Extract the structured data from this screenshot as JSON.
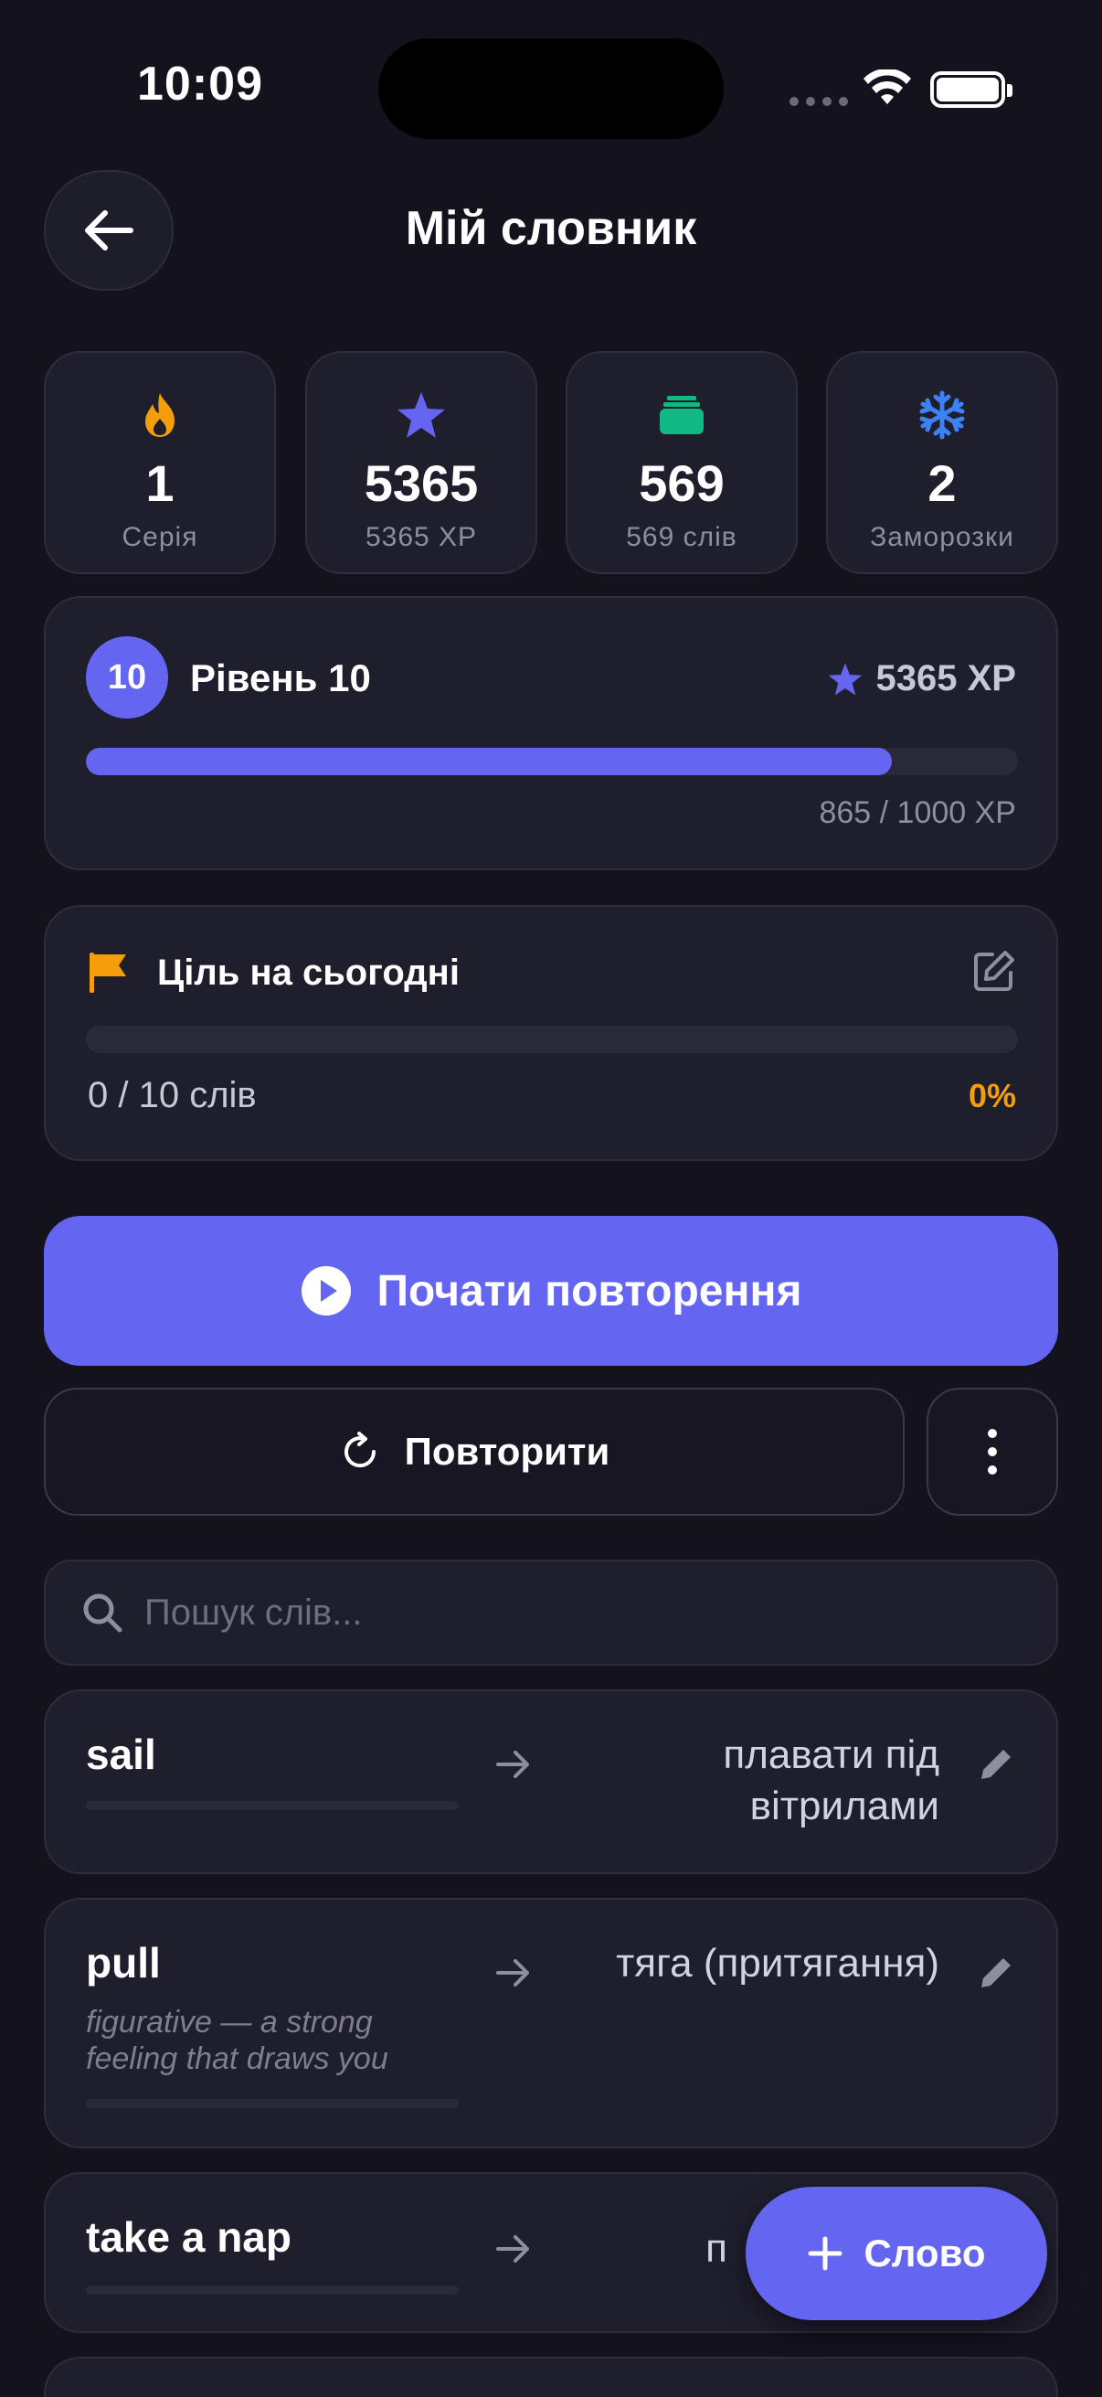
{
  "status": {
    "time": "10:09"
  },
  "header": {
    "title": "Мій словник"
  },
  "stats": [
    {
      "icon": "flame-icon",
      "value": "1",
      "label": "Серія",
      "color": "#f59e0b"
    },
    {
      "icon": "star-icon",
      "value": "5365",
      "label": "5365 XP",
      "color": "#6466f1"
    },
    {
      "icon": "cards-stack-icon",
      "value": "569",
      "label": "569 слів",
      "color": "#10b981"
    },
    {
      "icon": "snowflake-icon",
      "value": "2",
      "label": "Заморозки",
      "color": "#3b82f6"
    }
  ],
  "level": {
    "badge": "10",
    "title": "Рівень 10",
    "xp": "5365 XP",
    "progress": "865 / 1000 XP",
    "progress_fraction": 0.865
  },
  "goal": {
    "title": "Ціль на сьогодні",
    "count": "0 / 10 слів",
    "percent": "0%",
    "progress_fraction": 0
  },
  "actions": {
    "start_label": "Почати повторення",
    "repeat_label": "Повторити"
  },
  "search": {
    "placeholder": "Пошук слів..."
  },
  "words": [
    {
      "term": "sail",
      "translation_lines": [
        "плавати під",
        "вітрилами"
      ],
      "note": ""
    },
    {
      "term": "pull",
      "translation_lines": [
        "тяга (притягання)"
      ],
      "note": "figurative — a strong feeling that draws you"
    },
    {
      "term": "take a nap",
      "translation_lines": [
        "п"
      ],
      "note": ""
    }
  ],
  "fab": {
    "label": "Слово"
  },
  "colors": {
    "accent": "#6466f1",
    "background": "#13121d",
    "card": "#1f1e2d",
    "warning": "#f59e0b"
  }
}
